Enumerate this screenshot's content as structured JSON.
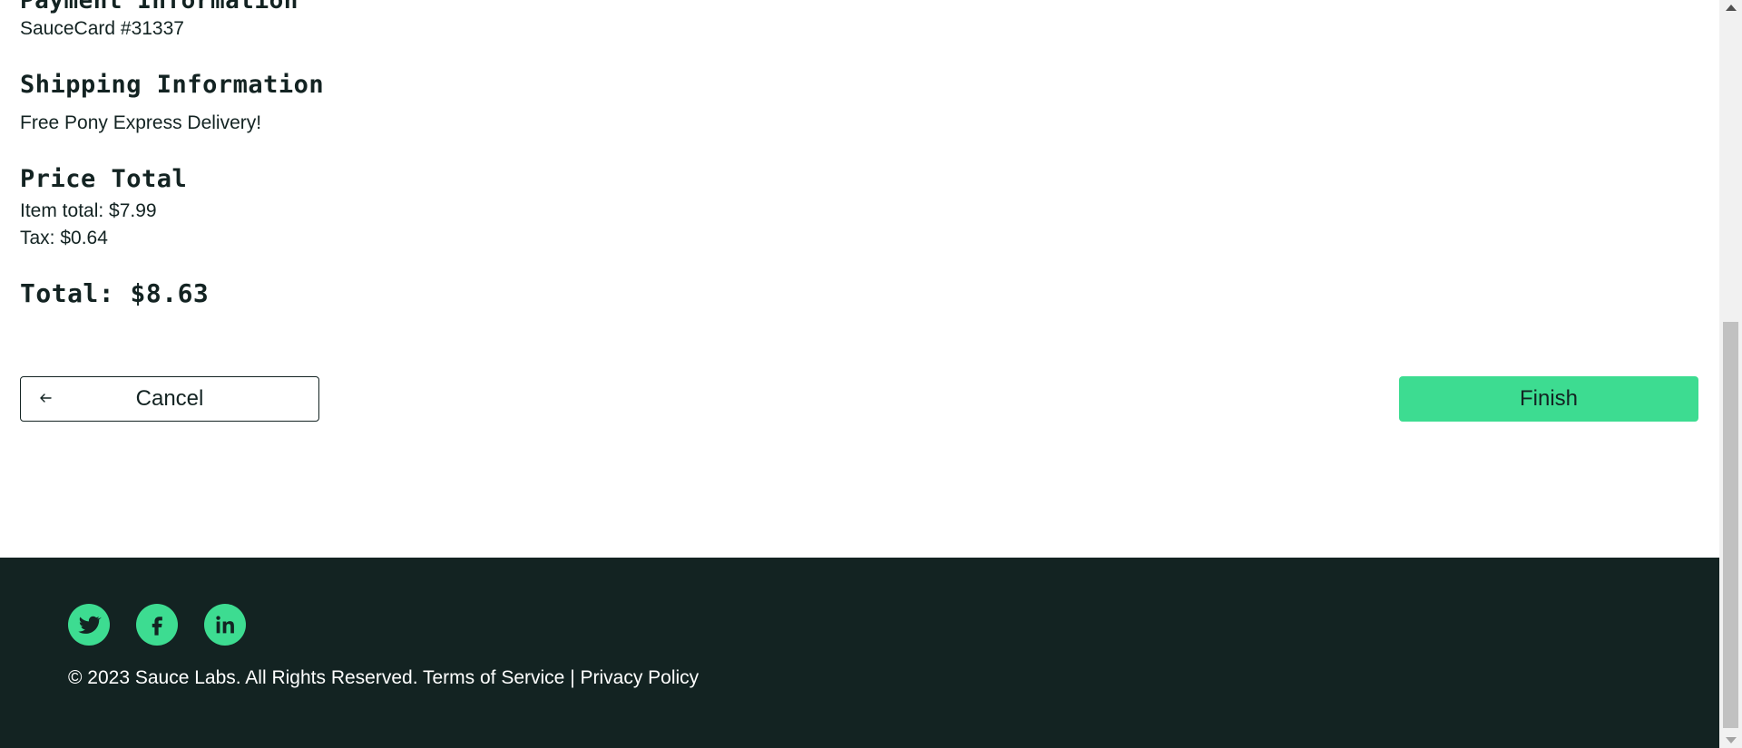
{
  "summary": {
    "payment_heading": "Payment Information",
    "payment_value": "SauceCard #31337",
    "shipping_heading": "Shipping Information",
    "shipping_value": "Free Pony Express Delivery!",
    "price_heading": "Price Total",
    "item_total": "Item total: $7.99",
    "tax": "Tax: $0.64",
    "total": "Total: $8.63"
  },
  "actions": {
    "cancel_label": "Cancel",
    "finish_label": "Finish"
  },
  "footer": {
    "social": [
      "twitter-icon",
      "facebook-icon",
      "linkedin-icon"
    ],
    "copy": "© 2023 Sauce Labs. All Rights Reserved. Terms of Service | Privacy Policy"
  },
  "colors": {
    "accent": "#3ddc91",
    "dark": "#132322"
  }
}
